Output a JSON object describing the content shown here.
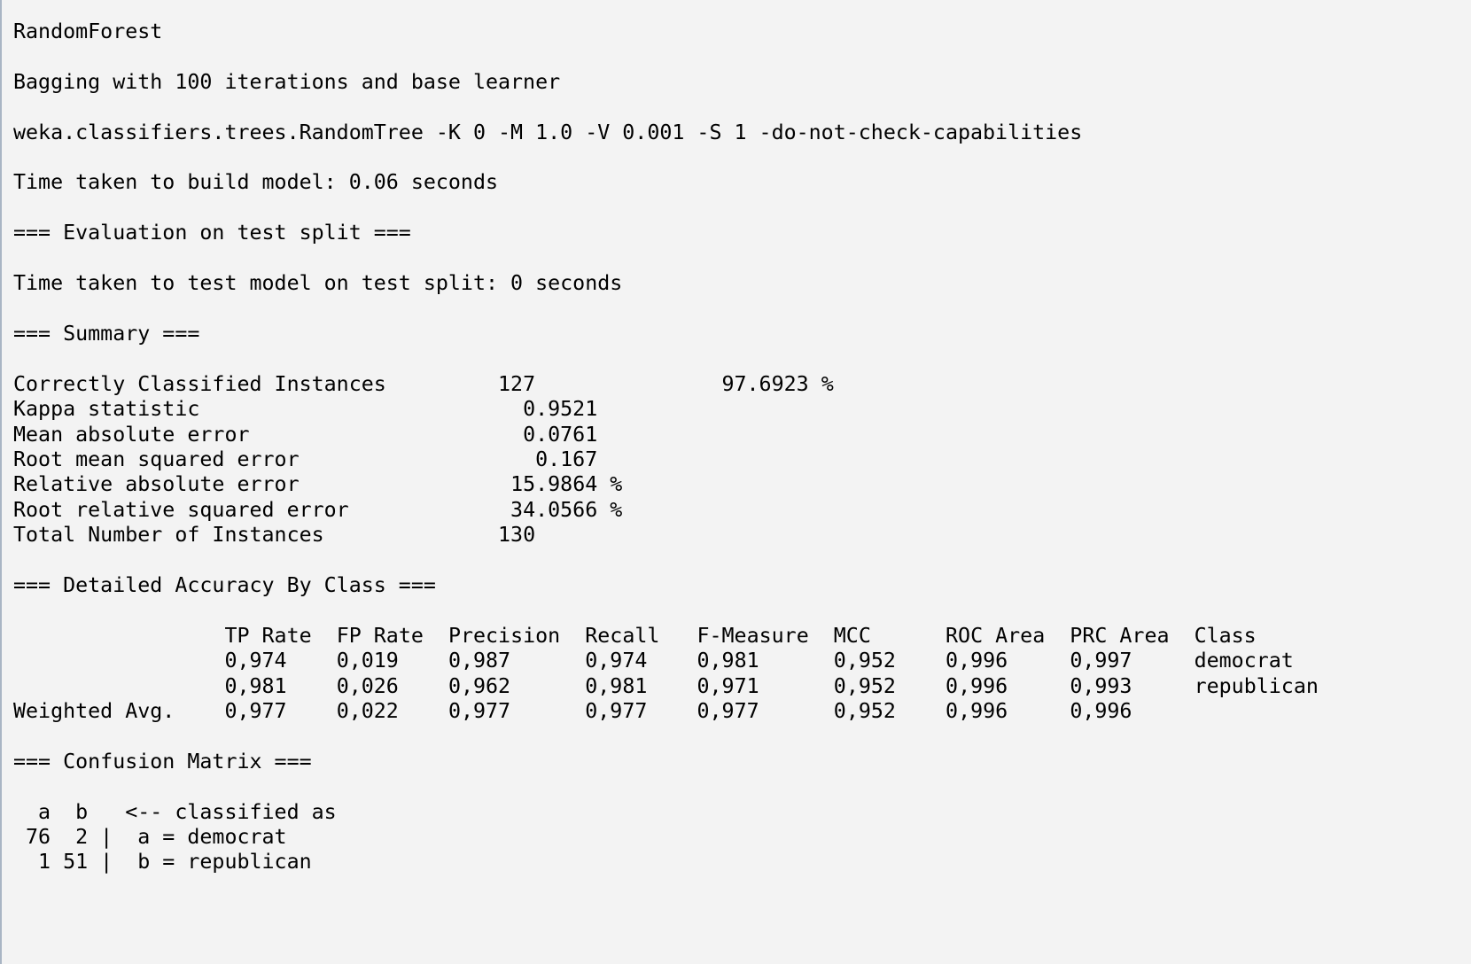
{
  "output": {
    "header": {
      "classifier_name": "RandomForest",
      "bagging_line": "Bagging with 100 iterations and base learner",
      "base_learner_line": "weka.classifiers.trees.RandomTree -K 0 -M 1.0 -V 0.001 -S 1 -do-not-check-capabilities",
      "build_time_line": "Time taken to build model: 0.06 seconds",
      "eval_section": "=== Evaluation on test split ===",
      "test_time_line": "Time taken to test model on test split: 0 seconds"
    },
    "summary": {
      "section": "=== Summary ===",
      "rows": [
        {
          "label": "Correctly Classified Instances",
          "value": "127",
          "extra": "97.6923 %"
        },
        {
          "label": "Kappa statistic",
          "value": "0.9521"
        },
        {
          "label": "Mean absolute error",
          "value": "0.0761"
        },
        {
          "label": "Root mean squared error",
          "value": "0.167"
        },
        {
          "label": "Relative absolute error",
          "value": "15.9864 %"
        },
        {
          "label": "Root relative squared error",
          "value": "34.0566 %"
        },
        {
          "label": "Total Number of Instances",
          "value": "130"
        }
      ]
    },
    "accuracy": {
      "section": "=== Detailed Accuracy By Class ===",
      "columns": [
        "TP Rate",
        "FP Rate",
        "Precision",
        "Recall",
        "F-Measure",
        "MCC",
        "ROC Area",
        "PRC Area",
        "Class"
      ],
      "rows": [
        {
          "label": "",
          "cells": [
            "0,974",
            "0,019",
            "0,987",
            "0,974",
            "0,981",
            "0,952",
            "0,996",
            "0,997",
            "democrat"
          ]
        },
        {
          "label": "",
          "cells": [
            "0,981",
            "0,026",
            "0,962",
            "0,981",
            "0,971",
            "0,952",
            "0,996",
            "0,993",
            "republican"
          ]
        },
        {
          "label": "Weighted Avg.",
          "cells": [
            "0,977",
            "0,022",
            "0,977",
            "0,977",
            "0,977",
            "0,952",
            "0,996",
            "0,996",
            ""
          ]
        }
      ]
    },
    "confusion": {
      "section": "=== Confusion Matrix ===",
      "header_line": "  a  b   <-- classified as",
      "rows": [
        " 76  2 |  a = democrat",
        "  1 51 |  b = republican"
      ]
    }
  }
}
